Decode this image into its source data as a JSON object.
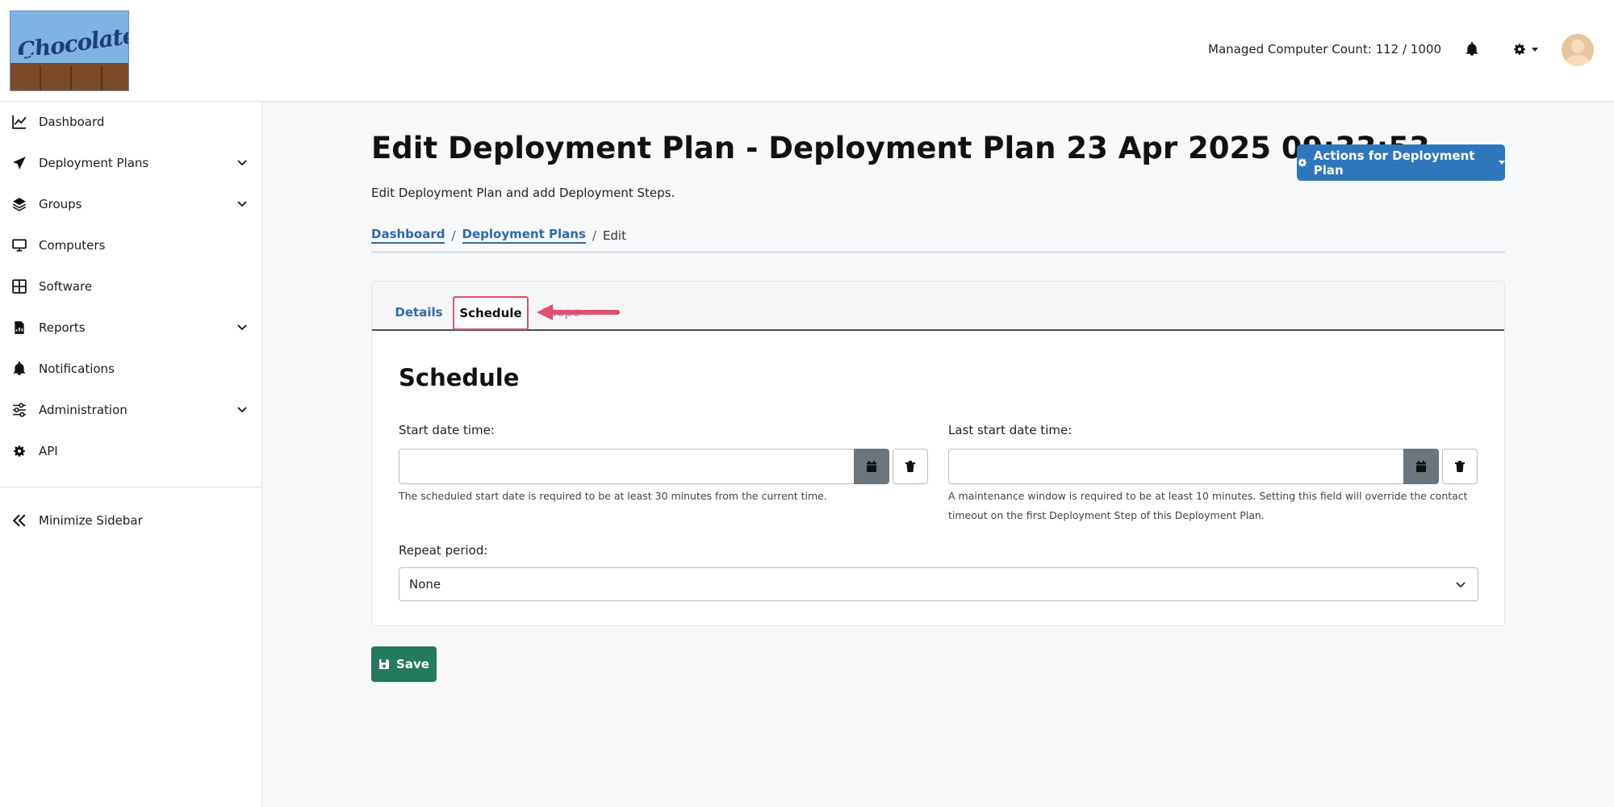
{
  "header": {
    "logo_text": "Chocolatey",
    "managed_count": "Managed Computer Count: 112 / 1000"
  },
  "sidebar": {
    "items": [
      {
        "label": "Dashboard",
        "icon": "chart-line-icon",
        "expandable": false
      },
      {
        "label": "Deployment Plans",
        "icon": "paper-plane-icon",
        "expandable": true
      },
      {
        "label": "Groups",
        "icon": "layers-icon",
        "expandable": true
      },
      {
        "label": "Computers",
        "icon": "desktop-icon",
        "expandable": false
      },
      {
        "label": "Software",
        "icon": "table-grid-icon",
        "expandable": false
      },
      {
        "label": "Reports",
        "icon": "file-chart-icon",
        "expandable": true
      },
      {
        "label": "Notifications",
        "icon": "bell-icon",
        "expandable": false
      },
      {
        "label": "Administration",
        "icon": "sliders-icon",
        "expandable": true
      },
      {
        "label": "API",
        "icon": "gear-icon",
        "expandable": false
      }
    ],
    "minimize_label": "Minimize Sidebar"
  },
  "page": {
    "title": "Edit Deployment Plan - Deployment Plan 23 Apr 2025 09:33:53",
    "subtitle": "Edit Deployment Plan and add Deployment Steps.",
    "actions_label": "Actions for Deployment Plan",
    "breadcrumb": {
      "dashboard": "Dashboard",
      "plans": "Deployment Plans",
      "current": "Edit",
      "separator": "/"
    }
  },
  "tabs": {
    "details": "Details",
    "schedule": "Schedule",
    "steps": "Steps"
  },
  "schedule": {
    "title": "Schedule",
    "start_label": "Start date time:",
    "start_value": "",
    "start_help": "The scheduled start date is required to be at least 30 minutes from the current time.",
    "last_label": "Last start date time:",
    "last_value": "",
    "last_help_1": "A maintenance window is required to be at least 10 minutes. Setting this field will override the contact",
    "last_help_2": "timeout on the first Deployment Step of this Deployment Plan.",
    "repeat_label": "Repeat period:",
    "repeat_value": "None"
  },
  "save_label": "Save",
  "colors": {
    "primary": "#2f77bd",
    "save": "#24795e",
    "highlight": "#e0506e"
  }
}
